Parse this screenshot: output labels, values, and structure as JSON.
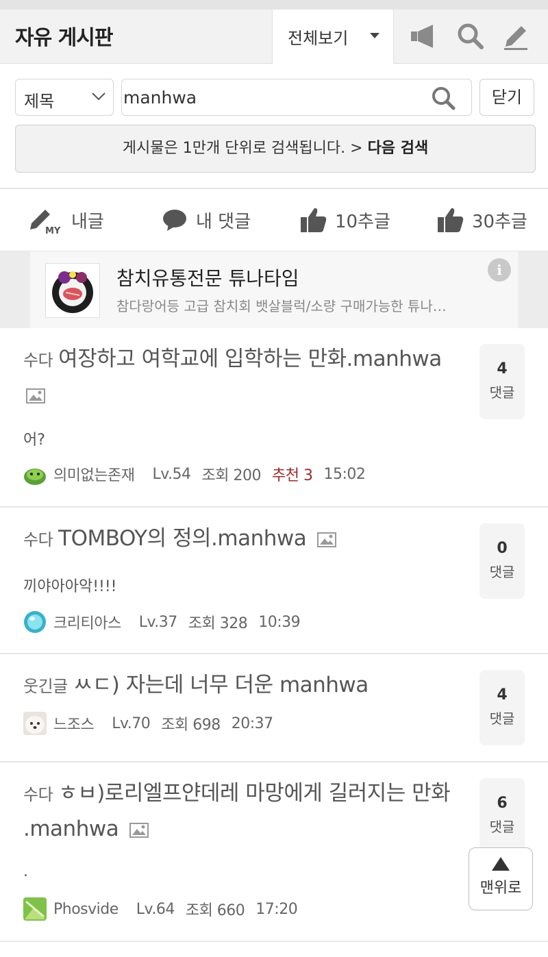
{
  "header": {
    "board_title": "자유 게시판",
    "view_select": "전체보기"
  },
  "search": {
    "field": "제목",
    "query": "manhwa",
    "close_label": "닫기",
    "notice_text": "게시물은 1만개 단위로 검색됩니다. >",
    "notice_link": "다음 검색"
  },
  "quick_tabs": [
    {
      "label": "내글",
      "icon": "my-posts-icon"
    },
    {
      "label": "내 댓글",
      "icon": "comment-bubble-icon"
    },
    {
      "label": "10추글",
      "icon": "thumbs-up-icon"
    },
    {
      "label": "30추글",
      "icon": "thumbs-up-icon"
    }
  ],
  "ad": {
    "title": "참치유통전문 튜나타임",
    "description": "참다랑어등 고급 참치회 뱃살블럭/소량 구매가능한 튜나…",
    "info": "i"
  },
  "posts": [
    {
      "category": "수다",
      "title": "여장하고 여학교에 입학하는 만화.manhwa",
      "has_image": true,
      "preview": "어?",
      "author": "의미없는존재",
      "level": "Lv.54",
      "views": "조회 200",
      "recommend": "추천 3",
      "time": "15:02",
      "comments": "4",
      "comments_label": "댓글"
    },
    {
      "category": "수다",
      "title": "TOMBOY의 정의.manhwa",
      "has_image": true,
      "preview": "끼야아아악!!!!",
      "author": "크리티아스",
      "level": "Lv.37",
      "views": "조회 328",
      "time": "10:39",
      "comments": "0",
      "comments_label": "댓글"
    },
    {
      "category": "웃긴글",
      "title": "ㅆㄷ) 자는데 너무 더운 manhwa",
      "has_image": false,
      "author": "느조스",
      "level": "Lv.70",
      "views": "조회 698",
      "time": "20:37",
      "comments": "4",
      "comments_label": "댓글"
    },
    {
      "category": "수다",
      "title": "ㅎㅂ)로리엘프얀데레 마망에게 길러지는 만화 .manhwa",
      "has_image": true,
      "preview": ".",
      "author": "Phosvide",
      "level": "Lv.64",
      "views": "조회 660",
      "time": "17:20",
      "comments": "6",
      "comments_label": "댓글"
    }
  ],
  "scroll_top_label": "맨위로",
  "colors": {
    "header_bg": "#f2f2f2",
    "recommend": "#9b2b2b",
    "comment_box_bg": "#f4f4f4"
  }
}
